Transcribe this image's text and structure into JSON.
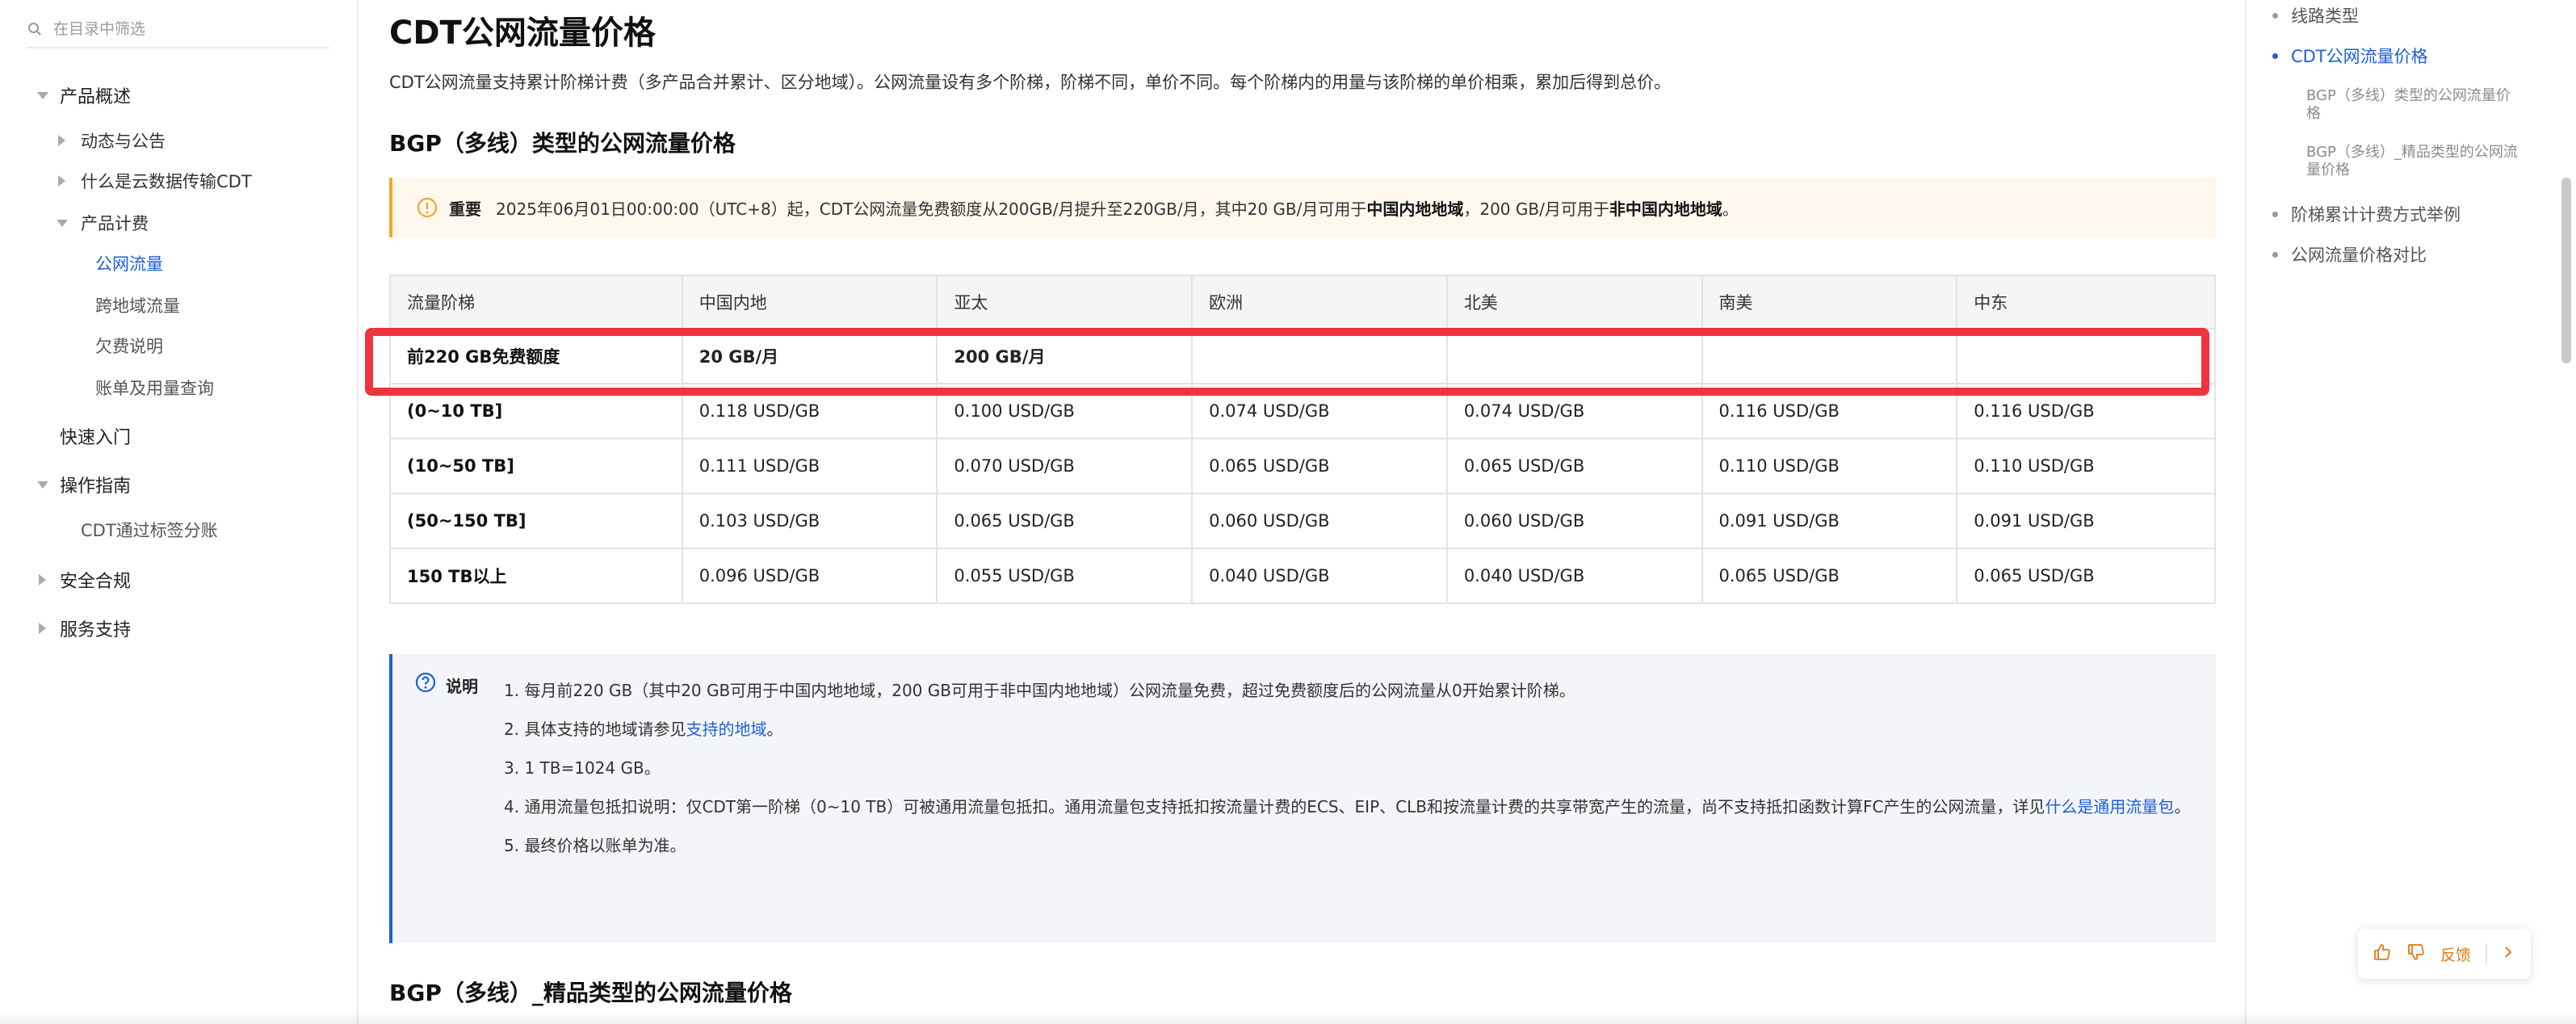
{
  "sidebar": {
    "filter_placeholder": "在目录中筛选",
    "items": [
      {
        "label": "产品概述"
      },
      {
        "label": "动态与公告"
      },
      {
        "label": "什么是云数据传输CDT"
      },
      {
        "label": "产品计费"
      },
      {
        "label": "公网流量"
      },
      {
        "label": "跨地域流量"
      },
      {
        "label": "欠费说明"
      },
      {
        "label": "账单及用量查询"
      },
      {
        "label": "快速入门"
      },
      {
        "label": "操作指南"
      },
      {
        "label": "CDT通过标签分账"
      },
      {
        "label": "安全合规"
      },
      {
        "label": "服务支持"
      }
    ]
  },
  "main": {
    "title": "CDT公网流量价格",
    "intro": "CDT公网流量支持累计阶梯计费（多产品合并累计、区分地域）。公网流量设有多个阶梯，阶梯不同，单价不同。每个阶梯内的用量与该阶梯的单价相乘，累加后得到总价。",
    "section1_title": "BGP（多线）类型的公网流量价格",
    "notice": {
      "label": "重要",
      "text_a": "2025年06月01日00:00:00（UTC+8）起，CDT公网流量免费额度从200GB/月提升至220GB/月，其中20 GB/月可用于",
      "bold_a": "中国内地地域",
      "text_b": "，200 GB/月可用于",
      "bold_b": "非中国内地地域",
      "text_c": "。"
    },
    "table": {
      "headers": [
        "流量阶梯",
        "中国内地",
        "亚太",
        "欧洲",
        "北美",
        "南美",
        "中东"
      ],
      "rows": [
        [
          "前220 GB免费额度",
          "20 GB/月",
          "200 GB/月",
          "",
          "",
          "",
          ""
        ],
        [
          "(0~10 TB]",
          "0.118 USD/GB",
          "0.100 USD/GB",
          "0.074 USD/GB",
          "0.074 USD/GB",
          "0.116 USD/GB",
          "0.116 USD/GB"
        ],
        [
          "(10~50 TB]",
          "0.111 USD/GB",
          "0.070 USD/GB",
          "0.065 USD/GB",
          "0.065 USD/GB",
          "0.110 USD/GB",
          "0.110 USD/GB"
        ],
        [
          "(50~150 TB]",
          "0.103 USD/GB",
          "0.065 USD/GB",
          "0.060 USD/GB",
          "0.060 USD/GB",
          "0.091 USD/GB",
          "0.091 USD/GB"
        ],
        [
          "150 TB以上",
          "0.096 USD/GB",
          "0.055 USD/GB",
          "0.040 USD/GB",
          "0.040 USD/GB",
          "0.065 USD/GB",
          "0.065 USD/GB"
        ]
      ]
    },
    "note": {
      "title": "说明",
      "item1": "1. 每月前220 GB（其中20 GB可用于中国内地地域，200 GB可用于非中国内地地域）公网流量免费，超过免费额度后的公网流量从0开始累计阶梯。",
      "item2_a": "2. 具体支持的地域请参见",
      "item2_link": "支持的地域",
      "item2_b": "。",
      "item3": "3. 1 TB=1024 GB。",
      "item4_a": "4. 通用流量包抵扣说明：仅CDT第一阶梯（0~10 TB）可被通用流量包抵扣。通用流量包支持抵扣按流量计费的ECS、EIP、CLB和按流量计费的共享带宽产生的流量，尚不支持抵扣函数计算FC产生的公网流量，详见",
      "item4_link": "什么是通用流量包",
      "item4_b": "。",
      "item5": "5. 最终价格以账单为准。"
    },
    "section2_title": "BGP（多线）_精品类型的公网流量价格"
  },
  "toc": {
    "items": [
      {
        "label": "线路类型"
      },
      {
        "label": "CDT公网流量价格"
      },
      {
        "label": "BGP（多线）类型的公网流量价格"
      },
      {
        "label": "BGP（多线）_精品类型的公网流量价格"
      },
      {
        "label": "阶梯累计计费方式举例"
      },
      {
        "label": "公网流量价格对比"
      }
    ]
  },
  "feedback": {
    "label": "反馈"
  },
  "colors": {
    "accent": "#1f5fd8",
    "highlight": "#f0333f",
    "notice_border": "#f5a623"
  }
}
